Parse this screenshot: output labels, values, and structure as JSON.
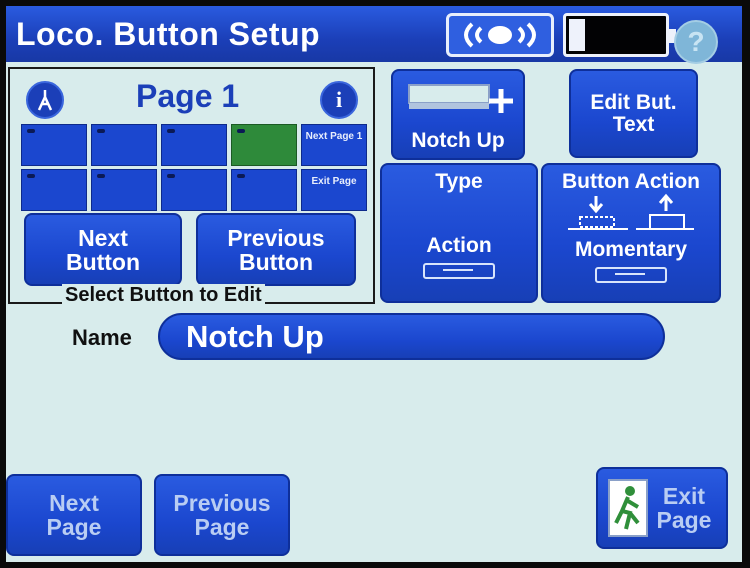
{
  "header": {
    "title": "Loco. Button Setup",
    "help_label": "?",
    "icons": [
      "wireless-signal-icon",
      "battery-icon",
      "help-icon"
    ]
  },
  "page_panel": {
    "title": "Page 1",
    "caption": "Select Button to Edit",
    "grid_cells": [
      {
        "label": "",
        "active": false
      },
      {
        "label": "",
        "active": false
      },
      {
        "label": "",
        "active": false
      },
      {
        "label": "",
        "active": true
      },
      {
        "label": "Next Page 1",
        "active": false
      },
      {
        "label": "",
        "active": false
      },
      {
        "label": "",
        "active": false
      },
      {
        "label": "",
        "active": false
      },
      {
        "label": "",
        "active": false
      },
      {
        "label": "Exit Page",
        "active": false
      }
    ],
    "next_button": "Next Button",
    "previous_button": "Previous Button",
    "info_icon_label": "i"
  },
  "button_preview": {
    "label": "Notch Up"
  },
  "edit_text_button": "Edit But. Text",
  "type_button": {
    "title": "Type",
    "value": "Action"
  },
  "action_button": {
    "title": "Button Action",
    "value": "Momentary"
  },
  "name_field": {
    "label": "Name",
    "value": "Notch Up"
  },
  "footer": {
    "next_page": "Next Page",
    "previous_page": "Previous Page",
    "exit_page": "Exit Page"
  },
  "colors": {
    "accent": "#1b47cf",
    "background": "#d8ecec",
    "active_cell": "#2e8a3a"
  }
}
